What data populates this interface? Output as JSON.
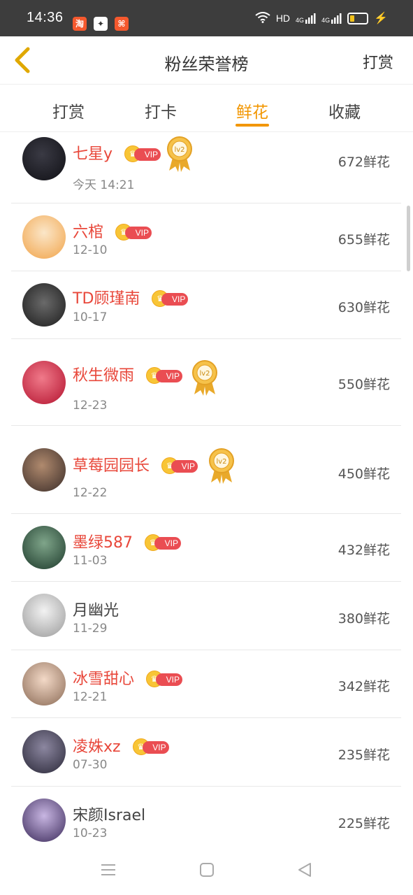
{
  "status": {
    "time": "14:36",
    "network": "HD",
    "sig1": "4G",
    "sig2": "4G"
  },
  "header": {
    "title": "粉丝荣誉榜",
    "right_action": "打赏"
  },
  "tabs": [
    {
      "label": "打赏"
    },
    {
      "label": "打卡"
    },
    {
      "label": "鲜花"
    },
    {
      "label": "收藏"
    }
  ],
  "active_tab": "鲜花",
  "vip_label": "VIP",
  "medal_label": "lv2",
  "rows": [
    {
      "name": "七星y",
      "date": "今天 14:21",
      "score": "672鲜花",
      "vip": true,
      "medal": true
    },
    {
      "name": "六棺",
      "date": "12-10",
      "score": "655鲜花",
      "vip": true,
      "medal": false
    },
    {
      "name": "TD顾瑾南",
      "date": "10-17",
      "score": "630鲜花",
      "vip": true,
      "medal": false
    },
    {
      "name": "秋生微雨",
      "date": "12-23",
      "score": "550鲜花",
      "vip": true,
      "medal": true
    },
    {
      "name": "草莓园园长",
      "date": "12-22",
      "score": "450鲜花",
      "vip": true,
      "medal": true
    },
    {
      "name": "墨绿587",
      "date": "11-03",
      "score": "432鲜花",
      "vip": true,
      "medal": false
    },
    {
      "name": "月幽光",
      "date": "11-29",
      "score": "380鲜花",
      "vip": false,
      "medal": false
    },
    {
      "name": "冰雪甜心",
      "date": "12-21",
      "score": "342鲜花",
      "vip": true,
      "medal": false
    },
    {
      "name": "凌姝xz",
      "date": "07-30",
      "score": "235鲜花",
      "vip": true,
      "medal": false
    },
    {
      "name": "宋颜Israel",
      "date": "10-23",
      "score": "225鲜花",
      "vip": false,
      "medal": false
    }
  ],
  "colors": {
    "accent": "#f29600",
    "vip_name": "#e8473a",
    "vip_tag": "#ea4d52"
  }
}
